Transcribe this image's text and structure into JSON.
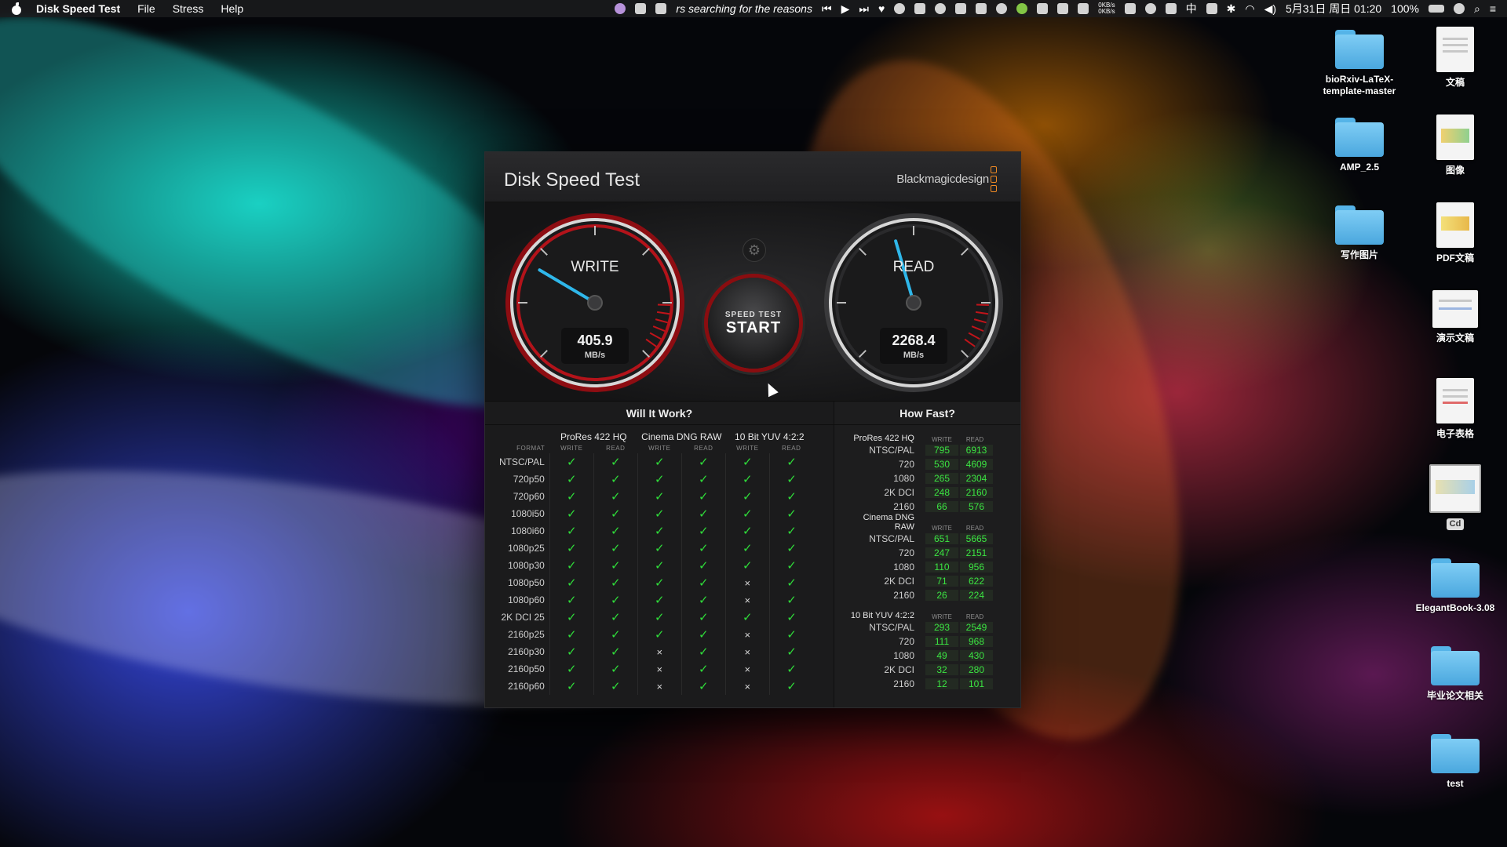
{
  "menubar": {
    "app_name": "Disk Speed Test",
    "menus": [
      "File",
      "Stress",
      "Help"
    ],
    "now_playing": "rs searching for the reasons",
    "net_up": "0KB/s",
    "net_down": "0KB/s",
    "input_method": "中",
    "datetime": "5月31日 周日 01:20",
    "battery": "100%"
  },
  "desktop": {
    "icons": [
      {
        "label": "bioRxiv-LaTeX-template-master",
        "kind": "folder"
      },
      {
        "label": "文稿",
        "kind": "doc"
      },
      {
        "label": "AMP_2.5",
        "kind": "folder"
      },
      {
        "label": "图像",
        "kind": "doc"
      },
      {
        "label": "写作图片",
        "kind": "folder"
      },
      {
        "label": "PDF文稿",
        "kind": "doc"
      },
      {
        "label": "演示文稿",
        "kind": "doc"
      },
      {
        "label": "电子表格",
        "kind": "doc"
      },
      {
        "label": "Cd",
        "kind": "doc"
      },
      {
        "label": "ElegantBook-3.08",
        "kind": "folder"
      },
      {
        "label": "毕业论文相关",
        "kind": "folder"
      },
      {
        "label": "test",
        "kind": "folder"
      }
    ]
  },
  "window": {
    "close_glyph": "×",
    "title": "Disk Speed Test",
    "brand": "Blackmagicdesign",
    "write": {
      "label": "WRITE",
      "value": "405.9",
      "unit": "MB/s",
      "needle_fraction": 0.28
    },
    "read": {
      "label": "READ",
      "value": "2268.4",
      "unit": "MB/s",
      "needle_fraction": 0.44
    },
    "start": {
      "top": "SPEED TEST",
      "bottom": "START"
    },
    "settings_glyph": "⚙"
  },
  "will_it_work": {
    "title": "Will It Work?",
    "groups": [
      "ProRes 422 HQ",
      "Cinema DNG RAW",
      "10 Bit YUV 4:2:2"
    ],
    "format_label": "FORMAT",
    "write_label": "WRITE",
    "read_label": "READ",
    "rows": [
      {
        "format": "NTSC/PAL",
        "cells": [
          1,
          1,
          1,
          1,
          1,
          1
        ]
      },
      {
        "format": "720p50",
        "cells": [
          1,
          1,
          1,
          1,
          1,
          1
        ]
      },
      {
        "format": "720p60",
        "cells": [
          1,
          1,
          1,
          1,
          1,
          1
        ]
      },
      {
        "format": "1080i50",
        "cells": [
          1,
          1,
          1,
          1,
          1,
          1
        ]
      },
      {
        "format": "1080i60",
        "cells": [
          1,
          1,
          1,
          1,
          1,
          1
        ]
      },
      {
        "format": "1080p25",
        "cells": [
          1,
          1,
          1,
          1,
          1,
          1
        ]
      },
      {
        "format": "1080p30",
        "cells": [
          1,
          1,
          1,
          1,
          1,
          1
        ]
      },
      {
        "format": "1080p50",
        "cells": [
          1,
          1,
          1,
          1,
          0,
          1
        ]
      },
      {
        "format": "1080p60",
        "cells": [
          1,
          1,
          1,
          1,
          0,
          1
        ]
      },
      {
        "format": "2K DCI 25",
        "cells": [
          1,
          1,
          1,
          1,
          1,
          1
        ]
      },
      {
        "format": "2160p25",
        "cells": [
          1,
          1,
          1,
          1,
          0,
          1
        ]
      },
      {
        "format": "2160p30",
        "cells": [
          1,
          1,
          0,
          1,
          0,
          1
        ]
      },
      {
        "format": "2160p50",
        "cells": [
          1,
          1,
          0,
          1,
          0,
          1
        ]
      },
      {
        "format": "2160p60",
        "cells": [
          1,
          1,
          0,
          1,
          0,
          1
        ]
      }
    ],
    "ok_glyph": "✓",
    "no_glyph": "×"
  },
  "how_fast": {
    "title": "How Fast?",
    "write_label": "WRITE",
    "read_label": "READ",
    "groups": [
      {
        "name": "ProRes 422 HQ",
        "rows": [
          {
            "format": "NTSC/PAL",
            "write": "795",
            "read": "6913"
          },
          {
            "format": "720",
            "write": "530",
            "read": "4609"
          },
          {
            "format": "1080",
            "write": "265",
            "read": "2304"
          },
          {
            "format": "2K DCI",
            "write": "248",
            "read": "2160"
          },
          {
            "format": "2160",
            "write": "66",
            "read": "576"
          }
        ]
      },
      {
        "name": "Cinema DNG RAW",
        "rows": [
          {
            "format": "NTSC/PAL",
            "write": "651",
            "read": "5665"
          },
          {
            "format": "720",
            "write": "247",
            "read": "2151"
          },
          {
            "format": "1080",
            "write": "110",
            "read": "956"
          },
          {
            "format": "2K DCI",
            "write": "71",
            "read": "622"
          },
          {
            "format": "2160",
            "write": "26",
            "read": "224"
          }
        ]
      },
      {
        "name": "10 Bit YUV 4:2:2",
        "rows": [
          {
            "format": "NTSC/PAL",
            "write": "293",
            "read": "2549"
          },
          {
            "format": "720",
            "write": "111",
            "read": "968"
          },
          {
            "format": "1080",
            "write": "49",
            "read": "430"
          },
          {
            "format": "2K DCI",
            "write": "32",
            "read": "280"
          },
          {
            "format": "2160",
            "write": "12",
            "read": "101"
          }
        ]
      }
    ]
  },
  "colors": {
    "ok": "#2fdc3a",
    "gauge_red": "#c0141a",
    "needle": "#2fb7ea",
    "brand_orange": "#f08a24"
  }
}
